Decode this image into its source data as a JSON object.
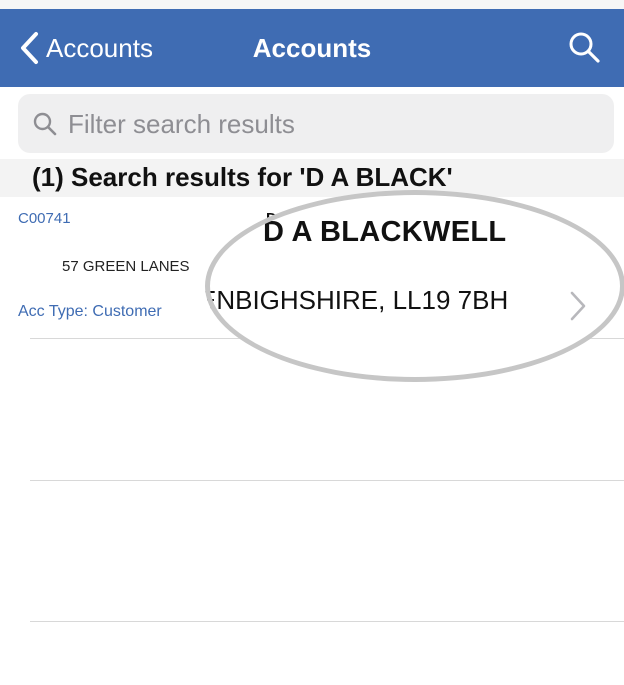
{
  "navbar": {
    "back_label": "Accounts",
    "title": "Accounts",
    "back_icon": "chevron-left-icon",
    "search_icon": "search-icon",
    "background_color": "#3f6cb3"
  },
  "search": {
    "placeholder": "Filter search results",
    "value": ""
  },
  "results": {
    "header": "(1) Search results for 'D A BLACK'",
    "items": [
      {
        "code": "C00741",
        "name": "D A BLACKWELL",
        "address_line": "57 GREEN LANE",
        "address_partial": "57 GREEN LANES",
        "address_magnified": "ENBIGHSHIRE, LL19 7BH",
        "type_label": "Acc Type: Customer"
      }
    ]
  },
  "colors": {
    "accent": "#3f6cb3",
    "header_bg": "#f3f3f3",
    "search_bg": "#efeff0"
  }
}
